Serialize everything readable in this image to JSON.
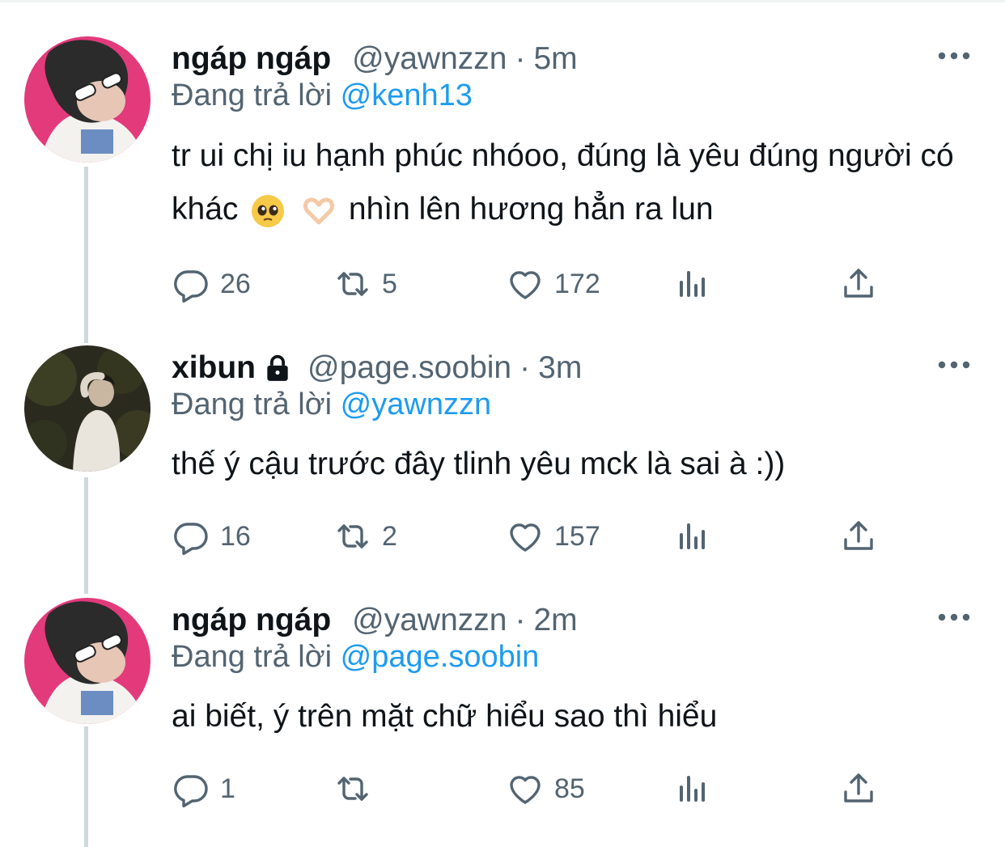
{
  "colors": {
    "mention": "#1d9bf0",
    "secondary": "#536471",
    "text": "#0f1419",
    "thread_line": "#cfd9de"
  },
  "icons": {
    "more": "more-horizontal-icon",
    "reply": "reply-icon",
    "retweet": "retweet-icon",
    "like": "heart-icon",
    "views": "views-icon",
    "share": "share-icon",
    "lock": "lock-icon"
  },
  "tweets": [
    {
      "name": "ngáp ngáp",
      "handle": "@yawnzzn",
      "separator": "·",
      "time": "5m",
      "reply_prefix": "Đang trả lời",
      "reply_to": "@kenh13",
      "text_part1": "tr ui chị iu hạnh phúc nhóoo, đúng là yêu đúng người có khác",
      "text_emojis": [
        "pleading-face-emoji",
        "heart-hands-emoji"
      ],
      "text_part2": "nhìn lên hương hẳn ra lun",
      "replies": "26",
      "retweets": "5",
      "likes": "172"
    },
    {
      "name": "xibun",
      "protected": true,
      "handle": "@page.soobin",
      "separator": "·",
      "time": "3m",
      "reply_prefix": "Đang trả lời",
      "reply_to": "@yawnzzn",
      "text": "thế ý cậu trước đây tlinh yêu mck là sai à :))",
      "replies": "16",
      "retweets": "2",
      "likes": "157"
    },
    {
      "name": "ngáp ngáp",
      "handle": "@yawnzzn",
      "separator": "·",
      "time": "2m",
      "reply_prefix": "Đang trả lời",
      "reply_to": "@page.soobin",
      "text": "ai biết, ý trên mặt chữ hiểu sao thì hiểu",
      "replies": "1",
      "retweets": "",
      "likes": "85"
    }
  ]
}
